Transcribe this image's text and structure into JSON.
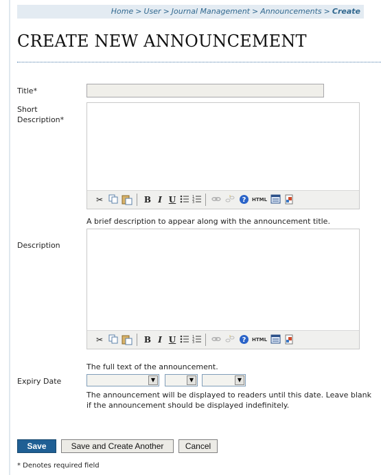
{
  "breadcrumb": {
    "home": "Home",
    "user": "User",
    "journal_management": "Journal Management",
    "announcements": "Announcements",
    "current": "Create",
    "separator": ">"
  },
  "page": {
    "title": "CREATE NEW ANNOUNCEMENT"
  },
  "form": {
    "title_label": "Title*",
    "short_description_label": "Short Description*",
    "short_description_help": "A brief description to appear along with the announcement title.",
    "description_label": "Description",
    "description_help": "The full text of the announcement.",
    "expiry_label": "Expiry Date",
    "expiry_help": "The announcement will be displayed to readers until this date. Leave blank if the announcement should be displayed indefinitely."
  },
  "editor_toolbar": {
    "icons": [
      "cut-icon",
      "copy-icon",
      "paste-icon",
      "bold-icon",
      "italic-icon",
      "underline-icon",
      "bullet-list-icon",
      "numbered-list-icon",
      "link-icon",
      "unlink-icon",
      "help-icon",
      "html-icon",
      "fullscreen-icon",
      "image-icon"
    ],
    "bold_glyph": "B",
    "italic_glyph": "I",
    "underline_glyph": "U",
    "html_glyph": "HTML"
  },
  "buttons": {
    "save": "Save",
    "save_and_create": "Save and Create Another",
    "cancel": "Cancel"
  },
  "footnote": "* Denotes required field",
  "colors": {
    "breadcrumb_bg": "#e3ebf2",
    "link": "#31688f",
    "primary_button": "#1f5f94"
  }
}
